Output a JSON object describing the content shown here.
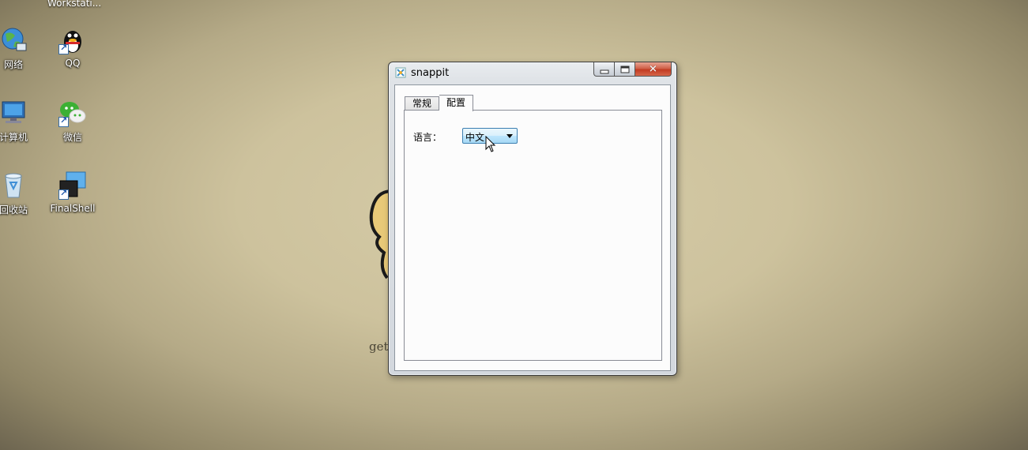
{
  "desktop": {
    "top_label": "Workstati...",
    "icons": [
      {
        "label": "网络",
        "icon": "network-icon"
      },
      {
        "label": "QQ",
        "icon": "qq-icon"
      },
      {
        "label": "计算机",
        "icon": "computer-icon"
      },
      {
        "label": "微信",
        "icon": "wechat-icon"
      },
      {
        "label": "回收站",
        "icon": "recycle-bin-icon"
      },
      {
        "label": "FinalShell",
        "icon": "finalshell-icon"
      }
    ],
    "wallpaper_text": "get"
  },
  "window": {
    "title": "snappit",
    "controls": {
      "close_glyph": "✕"
    },
    "tabs": [
      {
        "label": "常规",
        "active": false
      },
      {
        "label": "配置",
        "active": true
      }
    ],
    "settings": {
      "language_label": "语言：",
      "language_value": "中文"
    }
  },
  "colors": {
    "close_button": "#c23b22",
    "select_border": "#3c7fb1",
    "wallpaper": "#cdc29d"
  }
}
